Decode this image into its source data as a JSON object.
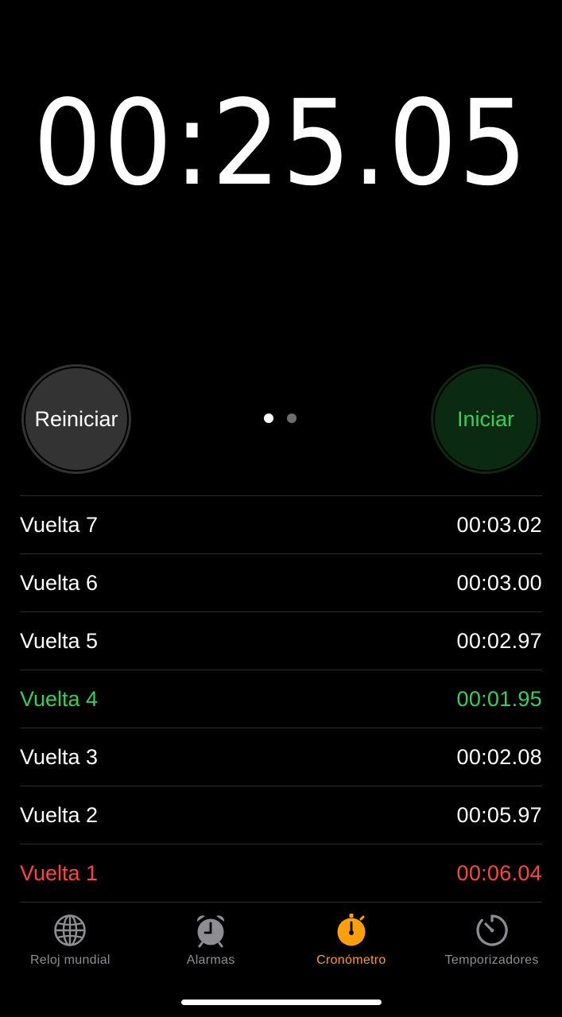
{
  "stopwatch": {
    "time": "00:25.05"
  },
  "controls": {
    "reset_label": "Reiniciar",
    "start_label": "Iniciar",
    "page_count": 2,
    "active_page": 1
  },
  "laps": [
    {
      "label": "Vuelta 7",
      "time": "00:03.02",
      "status": "normal"
    },
    {
      "label": "Vuelta 6",
      "time": "00:03.00",
      "status": "normal"
    },
    {
      "label": "Vuelta 5",
      "time": "00:02.97",
      "status": "normal"
    },
    {
      "label": "Vuelta 4",
      "time": "00:01.95",
      "status": "best"
    },
    {
      "label": "Vuelta 3",
      "time": "00:02.08",
      "status": "normal"
    },
    {
      "label": "Vuelta 2",
      "time": "00:05.97",
      "status": "normal"
    },
    {
      "label": "Vuelta 1",
      "time": "00:06.04",
      "status": "worst"
    }
  ],
  "tabbar": {
    "items": [
      {
        "label": "Reloj mundial",
        "icon": "globe-icon",
        "active": false
      },
      {
        "label": "Alarmas",
        "icon": "alarm-clock-icon",
        "active": false
      },
      {
        "label": "Cronómetro",
        "icon": "stopwatch-icon",
        "active": true
      },
      {
        "label": "Temporizadores",
        "icon": "timer-icon",
        "active": false
      }
    ]
  },
  "colors": {
    "background": "#000000",
    "best_lap": "#33d158",
    "worst_lap": "#ff453a",
    "accent_tab": "#ff9f0a",
    "inactive_tab": "#8d8d92",
    "reset_button": "#333333",
    "start_button_bg": "#0a2a12"
  }
}
